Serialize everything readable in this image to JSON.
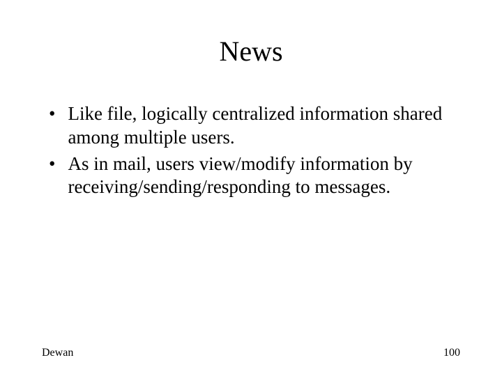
{
  "slide": {
    "title": "News",
    "bullets": [
      "Like file, logically centralized information shared among multiple users.",
      "As in mail, users view/modify information by receiving/sending/responding to messages."
    ]
  },
  "footer": {
    "author": "Dewan",
    "page": "100"
  }
}
